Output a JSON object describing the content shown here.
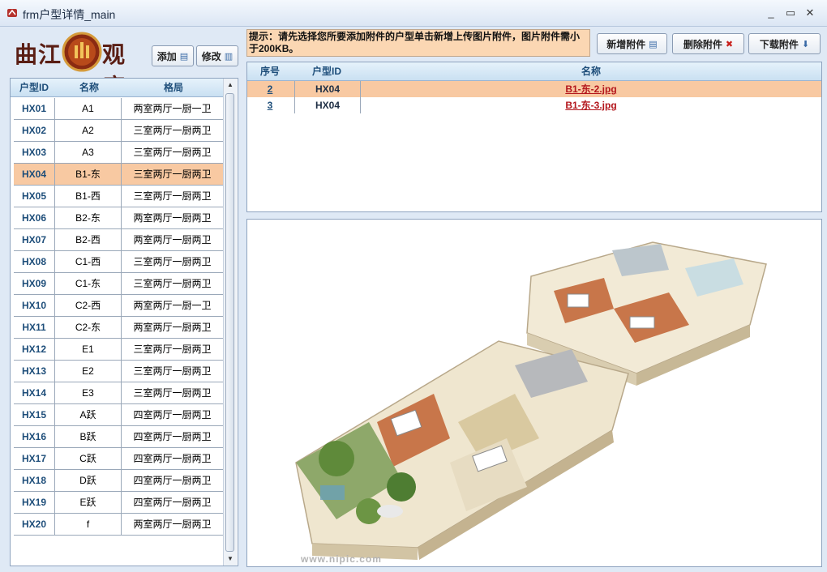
{
  "window": {
    "title": "frm户型详情_main",
    "controls": {
      "minimize": "_",
      "maximize": "▭",
      "close": "✕"
    }
  },
  "logo": {
    "text_left": "曲江",
    "text_right": "观唐"
  },
  "buttons": {
    "add": "添加",
    "edit": "修改",
    "new_attachment": "新增附件",
    "delete_attachment": "删除附件",
    "download_attachment": "下载附件"
  },
  "house_types": {
    "headers": [
      "户型ID",
      "名称",
      "格局"
    ],
    "selected": "HX04",
    "rows": [
      {
        "id": "HX01",
        "name": "A1",
        "layout": "两室两厅一厨一卫"
      },
      {
        "id": "HX02",
        "name": "A2",
        "layout": "三室两厅一厨两卫"
      },
      {
        "id": "HX03",
        "name": "A3",
        "layout": "三室两厅一厨两卫"
      },
      {
        "id": "HX04",
        "name": "B1-东",
        "layout": "三室两厅一厨两卫"
      },
      {
        "id": "HX05",
        "name": "B1-西",
        "layout": "三室两厅一厨两卫"
      },
      {
        "id": "HX06",
        "name": "B2-东",
        "layout": "两室两厅一厨两卫"
      },
      {
        "id": "HX07",
        "name": "B2-西",
        "layout": "两室两厅一厨两卫"
      },
      {
        "id": "HX08",
        "name": "C1-西",
        "layout": "三室两厅一厨两卫"
      },
      {
        "id": "HX09",
        "name": "C1-东",
        "layout": "三室两厅一厨两卫"
      },
      {
        "id": "HX10",
        "name": "C2-西",
        "layout": "两室两厅一厨一卫"
      },
      {
        "id": "HX11",
        "name": "C2-东",
        "layout": "两室两厅一厨两卫"
      },
      {
        "id": "HX12",
        "name": "E1",
        "layout": "三室两厅一厨两卫"
      },
      {
        "id": "HX13",
        "name": "E2",
        "layout": "三室两厅一厨两卫"
      },
      {
        "id": "HX14",
        "name": "E3",
        "layout": "三室两厅一厨两卫"
      },
      {
        "id": "HX15",
        "name": "A跃",
        "layout": "四室两厅一厨两卫"
      },
      {
        "id": "HX16",
        "name": "B跃",
        "layout": "四室两厅一厨两卫"
      },
      {
        "id": "HX17",
        "name": "C跃",
        "layout": "四室两厅一厨两卫"
      },
      {
        "id": "HX18",
        "name": "D跃",
        "layout": "四室两厅一厨两卫"
      },
      {
        "id": "HX19",
        "name": "E跃",
        "layout": "四室两厅一厨两卫"
      },
      {
        "id": "HX20",
        "name": "f",
        "layout": "两室两厅一厨两卫"
      }
    ]
  },
  "hint": "提示：请先选择您所要添加附件的户型单击新增上传图片附件，图片附件需小于200KB。",
  "attachments": {
    "headers": [
      "序号",
      "户型ID",
      "名称"
    ],
    "rows": [
      {
        "no": "2",
        "house_id": "HX04",
        "name": "B1-东-2.jpg"
      },
      {
        "no": "3",
        "house_id": "HX04",
        "name": "B1-东-3.jpg"
      }
    ]
  },
  "image_watermark": "www.nipic.com",
  "colors": {
    "selection": "#f8c9a2",
    "header_text": "#1e4e7a",
    "link_red": "#b3161c",
    "hint_bg": "#fbd7b3"
  }
}
